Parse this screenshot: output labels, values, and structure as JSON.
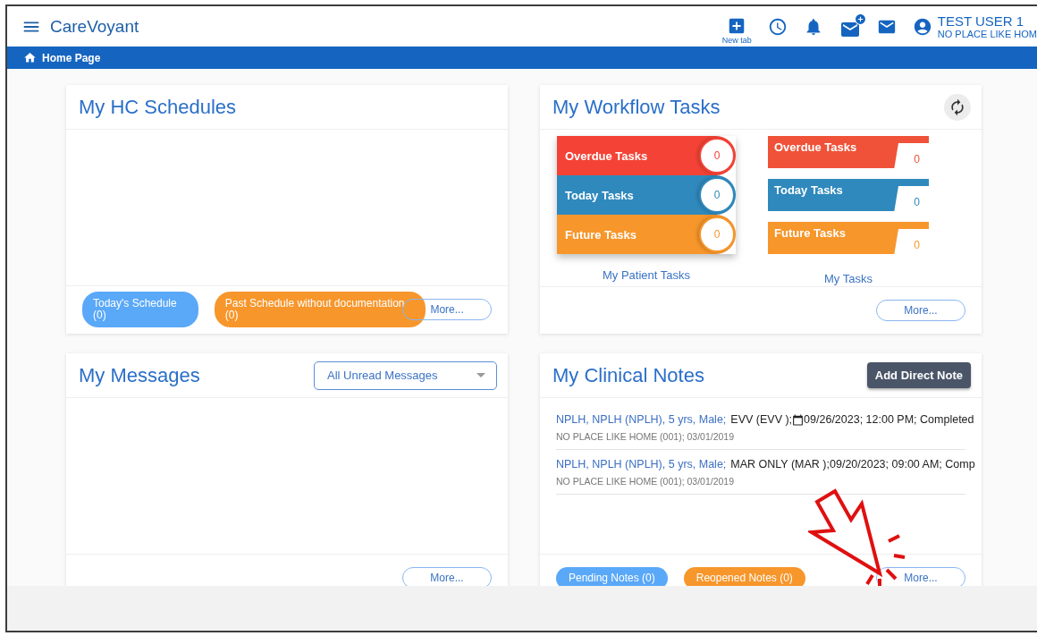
{
  "header": {
    "logo": "CareVoyant",
    "new_tab_label": "New tab",
    "user_name": "TEST USER 1",
    "user_org": "NO PLACE LIKE HOM"
  },
  "breadcrumb": {
    "label": "Home Page"
  },
  "schedules": {
    "title": "My HC Schedules",
    "pills": [
      {
        "label": "Today's Schedule",
        "count": "(0)",
        "color": "#5aa8f8"
      },
      {
        "label": "Past Schedule without documentation",
        "count": "(0)",
        "color": "#f7962b"
      }
    ],
    "more": "More..."
  },
  "workflow": {
    "title": "My Workflow Tasks",
    "patient_tasks": {
      "label": "My Patient Tasks",
      "items": [
        {
          "label": "Overdue Tasks",
          "count": "0",
          "color": "#f44336"
        },
        {
          "label": "Today Tasks",
          "count": "0",
          "color": "#2f89bd"
        },
        {
          "label": "Future Tasks",
          "count": "0",
          "color": "#f7962b"
        }
      ]
    },
    "my_tasks": {
      "label": "My Tasks",
      "items": [
        {
          "label": "Overdue Tasks",
          "count": "0",
          "color": "#ef5238"
        },
        {
          "label": "Today Tasks",
          "count": "0",
          "color": "#2f89bd"
        },
        {
          "label": "Future Tasks",
          "count": "0",
          "color": "#f7962b"
        }
      ]
    },
    "more": "More..."
  },
  "messages": {
    "title": "My Messages",
    "filter": "All Unread Messages",
    "more": "More..."
  },
  "clinical_notes": {
    "title": "My Clinical Notes",
    "add_button": "Add Direct Note",
    "notes": [
      {
        "patient": "NPLH, NPLH (NPLH), 5 yrs, Male;",
        "visit": "EVV (EVV );",
        "calendar_icon": true,
        "date_time": "09/26/2023; 12:00 PM; Completed",
        "meta": "NO PLACE LIKE HOME (001); 03/01/2019"
      },
      {
        "patient": "NPLH, NPLH (NPLH), 5 yrs, Male;",
        "visit": "MAR ONLY (MAR );",
        "calendar_icon": false,
        "date_time": "09/20/2023; 09:00 AM; Comp",
        "meta": "NO PLACE LIKE HOME (001); 03/01/2019"
      }
    ],
    "pills": [
      {
        "label": "Pending Notes (0)",
        "color": "#5aa8f8"
      },
      {
        "label": "Reopened Notes (0)",
        "color": "#f7962b"
      }
    ],
    "more": "More..."
  }
}
